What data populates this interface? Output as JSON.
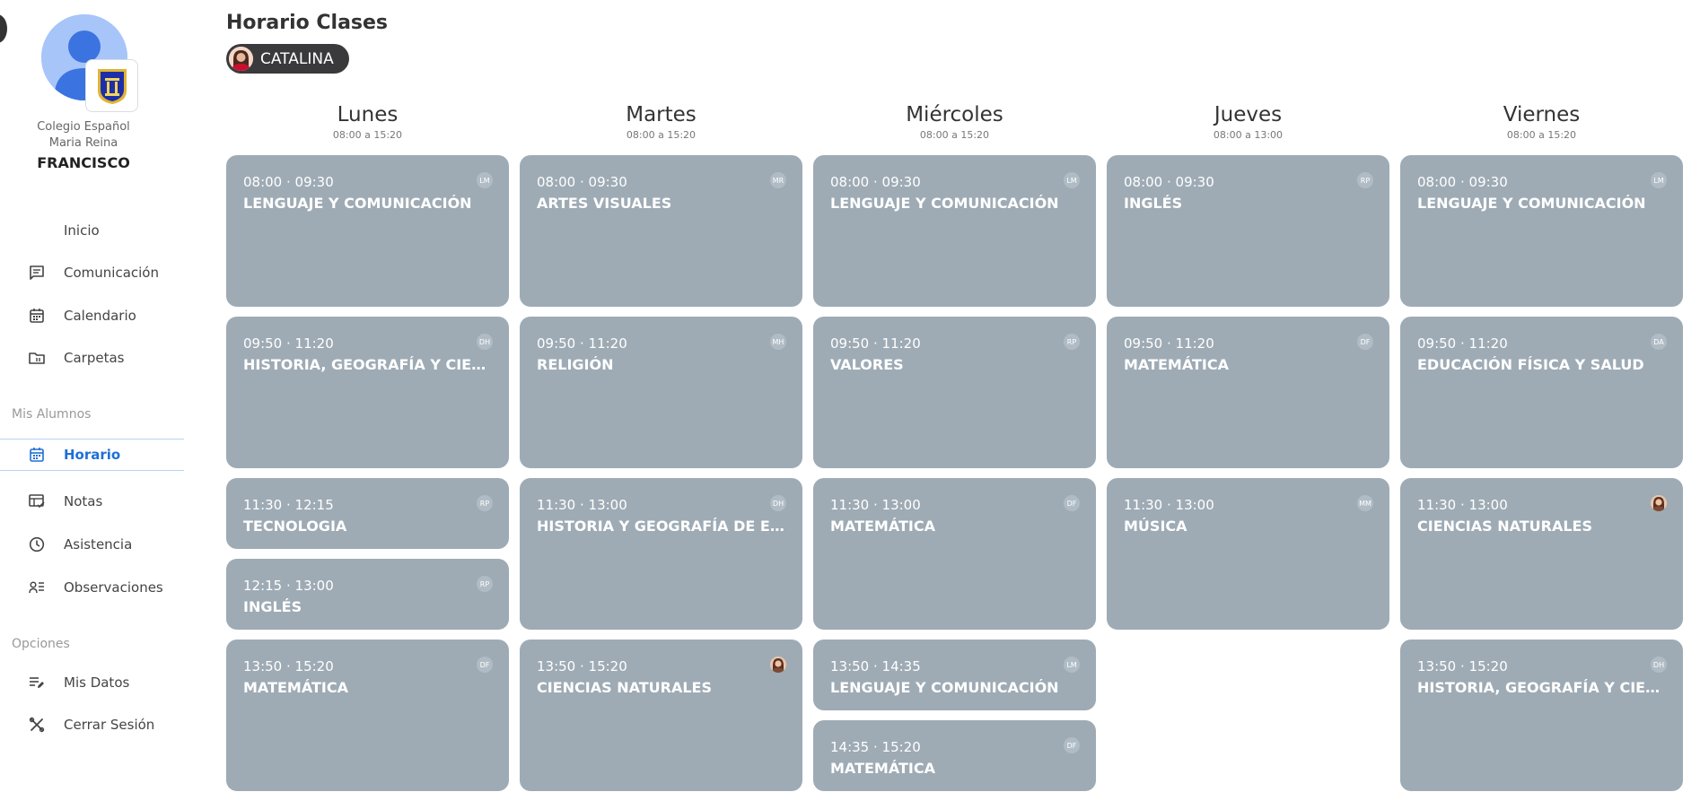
{
  "sidebar": {
    "school_line1": "Colegio Español",
    "school_line2": "Maria Reina",
    "user_name": "FRANCISCO",
    "nav": [
      {
        "label": "Inicio",
        "icon": "home-icon"
      },
      {
        "label": "Comunicación",
        "icon": "message-icon"
      },
      {
        "label": "Calendario",
        "icon": "calendar-icon"
      },
      {
        "label": "Carpetas",
        "icon": "folder-icon"
      }
    ],
    "section_students": "Mis Alumnos",
    "students_nav": [
      {
        "label": "Horario",
        "icon": "calendar-icon",
        "active": true
      },
      {
        "label": "Notas",
        "icon": "grades-icon"
      },
      {
        "label": "Asistencia",
        "icon": "clock-icon"
      },
      {
        "label": "Observaciones",
        "icon": "observations-icon"
      }
    ],
    "section_options": "Opciones",
    "options_nav": [
      {
        "label": "Mis Datos",
        "icon": "edit-list-icon"
      },
      {
        "label": "Cerrar Sesión",
        "icon": "logout-icon"
      }
    ]
  },
  "header": {
    "title": "Horario Clases",
    "student": "CATALINA"
  },
  "colors": {
    "card": "#9eabb5",
    "accent": "#1f6fd6",
    "chip": "#3a3a3c"
  },
  "days": [
    {
      "name": "Lunes",
      "range": "08:00 a 15:20",
      "classes": [
        {
          "time": "08:00 · 09:30",
          "subject": "LENGUAJE Y COMUNICACIÓN",
          "teacher": "LM"
        },
        {
          "time": "09:50 · 11:20",
          "subject": "HISTORIA, GEOGRAFÍA Y CIENCIAS",
          "teacher": "DH"
        },
        {
          "time": "11:30 · 12:15",
          "subject": "TECNOLOGIA",
          "teacher": "RP"
        },
        {
          "time": "12:15 · 13:00",
          "subject": "INGLÉS",
          "teacher": "RP"
        },
        {
          "time": "13:50 · 15:20",
          "subject": "MATEMÁTICA",
          "teacher": "DF"
        }
      ]
    },
    {
      "name": "Martes",
      "range": "08:00 a 15:20",
      "classes": [
        {
          "time": "08:00 · 09:30",
          "subject": "ARTES VISUALES",
          "teacher": "MR"
        },
        {
          "time": "09:50 · 11:20",
          "subject": "RELIGIÓN",
          "teacher": "MH"
        },
        {
          "time": "11:30 · 13:00",
          "subject": "HISTORIA Y GEOGRAFÍA DE ESPAÑA",
          "teacher": "DH"
        },
        {
          "time": "13:50 · 15:20",
          "subject": "CIENCIAS NATURALES",
          "teacher": "photo"
        }
      ]
    },
    {
      "name": "Miércoles",
      "range": "08:00 a 15:20",
      "classes": [
        {
          "time": "08:00 · 09:30",
          "subject": "LENGUAJE Y COMUNICACIÓN",
          "teacher": "LM"
        },
        {
          "time": "09:50 · 11:20",
          "subject": "VALORES",
          "teacher": "RP"
        },
        {
          "time": "11:30 · 13:00",
          "subject": "MATEMÁTICA",
          "teacher": "DF"
        },
        {
          "time": "13:50 · 14:35",
          "subject": "LENGUAJE Y COMUNICACIÓN",
          "teacher": "LM"
        },
        {
          "time": "14:35 · 15:20",
          "subject": "MATEMÁTICA",
          "teacher": "DF"
        }
      ]
    },
    {
      "name": "Jueves",
      "range": "08:00 a 13:00",
      "classes": [
        {
          "time": "08:00 · 09:30",
          "subject": "INGLÉS",
          "teacher": "RP"
        },
        {
          "time": "09:50 · 11:20",
          "subject": "MATEMÁTICA",
          "teacher": "DF"
        },
        {
          "time": "11:30 · 13:00",
          "subject": "MÚSICA",
          "teacher": "MM"
        }
      ]
    },
    {
      "name": "Viernes",
      "range": "08:00 a 15:20",
      "classes": [
        {
          "time": "08:00 · 09:30",
          "subject": "LENGUAJE Y COMUNICACIÓN",
          "teacher": "LM"
        },
        {
          "time": "09:50 · 11:20",
          "subject": "EDUCACIÓN FÍSICA Y SALUD",
          "teacher": "DA"
        },
        {
          "time": "11:30 · 13:00",
          "subject": "CIENCIAS NATURALES",
          "teacher": "photo"
        },
        {
          "time": "13:50 · 15:20",
          "subject": "HISTORIA, GEOGRAFÍA Y CIENCIAS",
          "teacher": "DH"
        }
      ]
    }
  ]
}
